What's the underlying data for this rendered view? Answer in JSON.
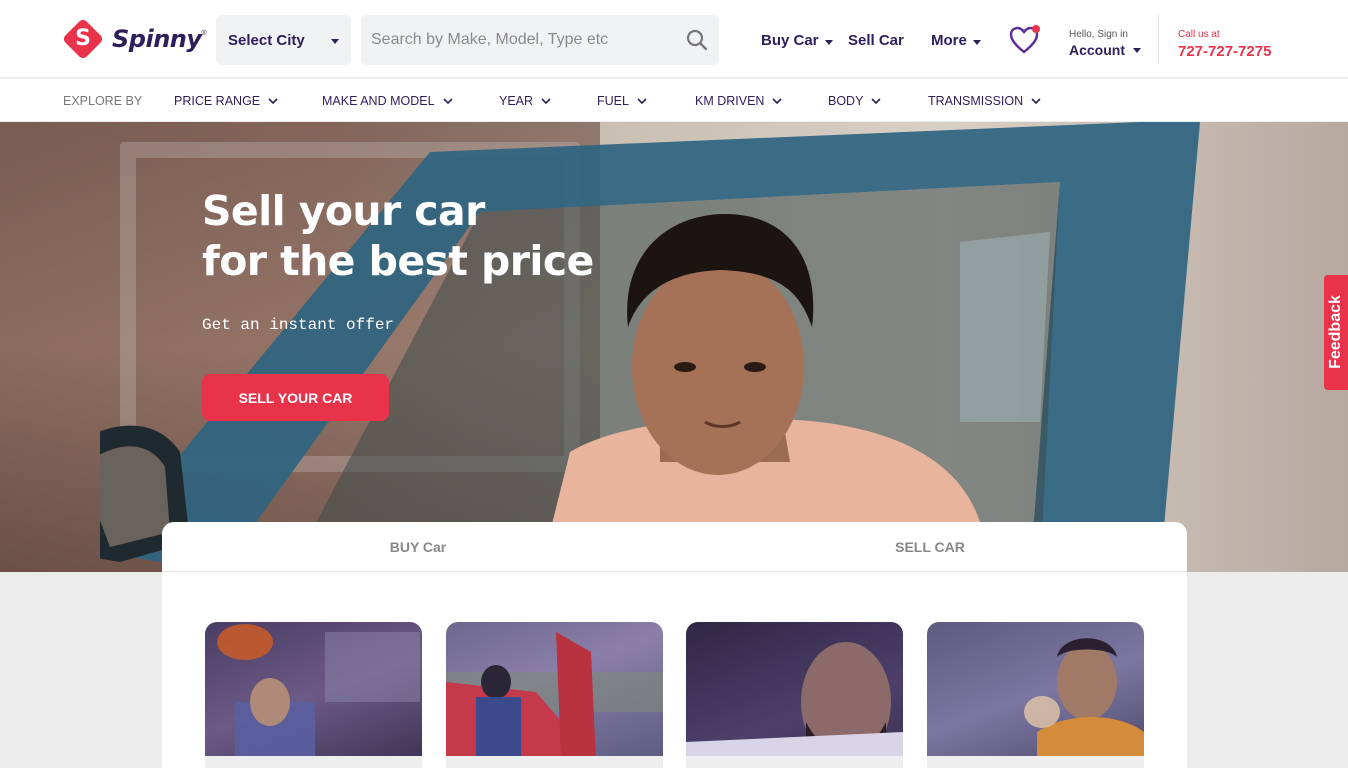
{
  "brand": {
    "name": "Spinny",
    "reg": "®",
    "logo_letter": "S",
    "color": "#e8334a",
    "dark": "#2e1e5b"
  },
  "header": {
    "city_label": "Select City",
    "search_placeholder": "Search by Make, Model, Type etc",
    "nav": [
      "Buy Car",
      "Sell Car",
      "More"
    ],
    "account_hello": "Hello, Sign in",
    "account_label": "Account",
    "call_label": "Call us at",
    "phone": "727-727-7275"
  },
  "explore": {
    "label": "EXPLORE BY",
    "items": [
      "PRICE RANGE",
      "MAKE AND MODEL",
      "YEAR",
      "FUEL",
      "KM DRIVEN",
      "BODY",
      "TRANSMISSION"
    ]
  },
  "hero": {
    "title_line1": "Sell your car",
    "title_line2": "for the best price",
    "subtitle": "Get an instant offer",
    "cta": "SELL YOUR CAR"
  },
  "feedback": "Feedback",
  "tabs": [
    "BUY Car",
    "SELL CAR"
  ],
  "cards": [
    "card-inspection",
    "card-car-door",
    "card-smiling-man",
    "card-driver"
  ]
}
